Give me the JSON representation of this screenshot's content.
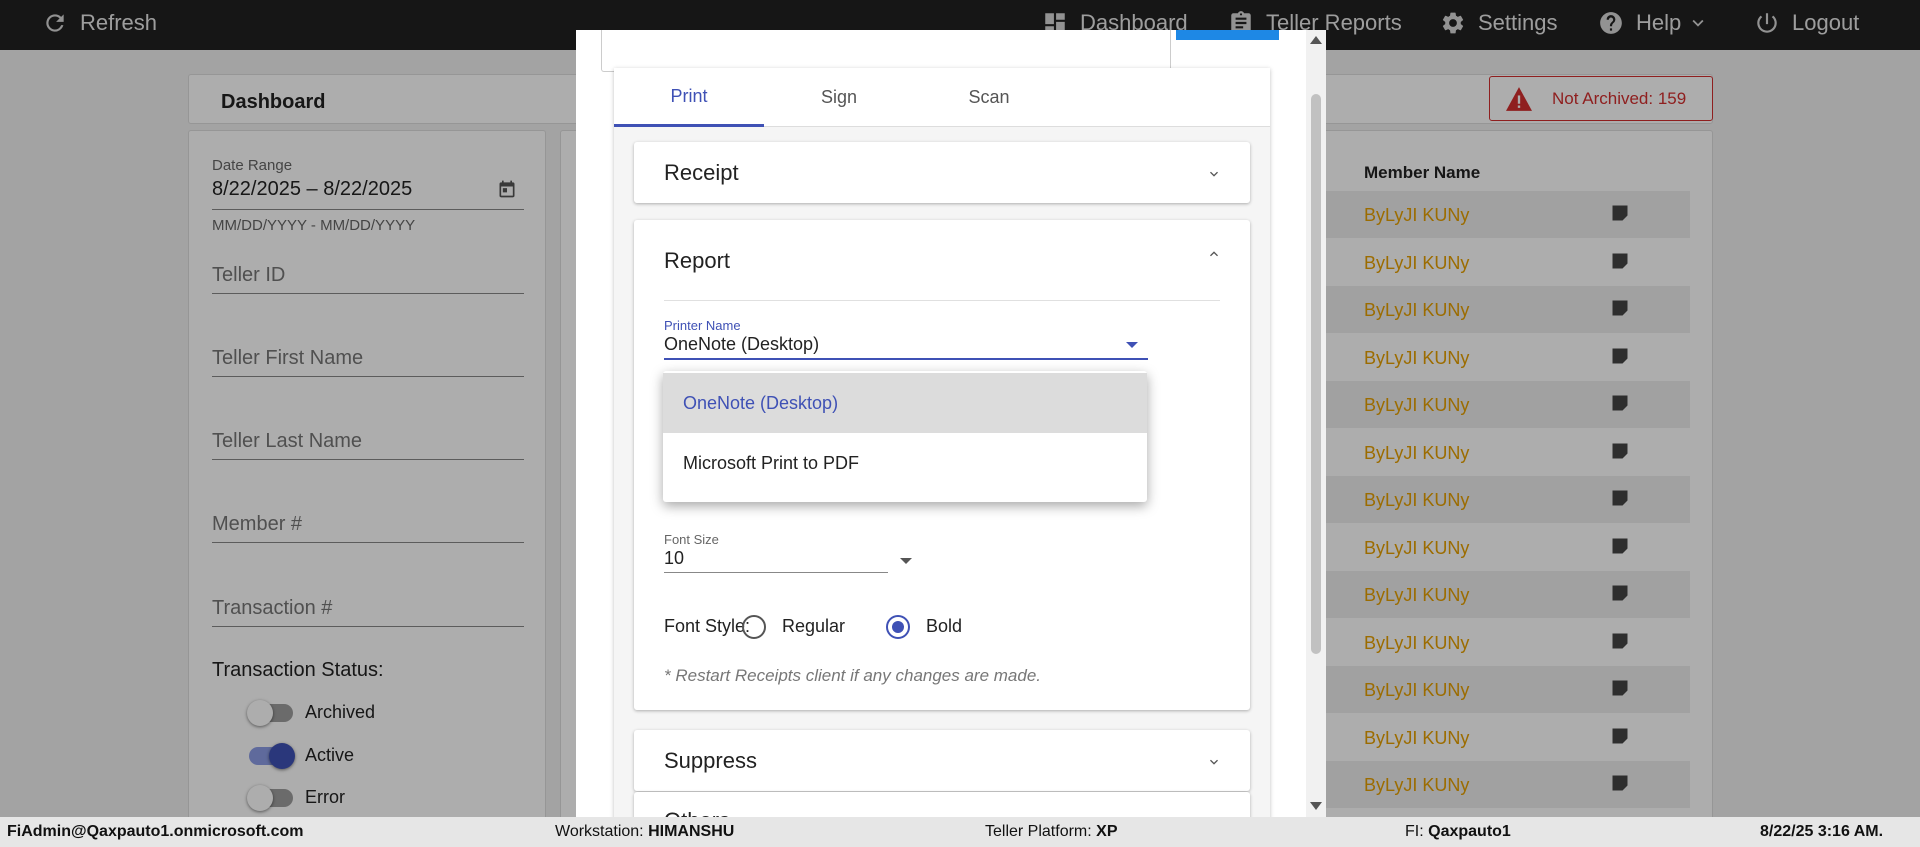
{
  "topbar": {
    "refresh": "Refresh",
    "dashboard": "Dashboard",
    "teller_reports": "Teller Reports",
    "settings": "Settings",
    "help": "Help",
    "logout": "Logout"
  },
  "dashboard": {
    "title": "Dashboard",
    "not_archived": "Not Archived: 159",
    "not_archived_color": "#d32f2f"
  },
  "filters": {
    "date_range_label": "Date Range",
    "date_range_value": "8/22/2025 – 8/22/2025",
    "date_hint": "MM/DD/YYYY - MM/DD/YYYY",
    "teller_id": "Teller ID",
    "teller_first_name": "Teller First Name",
    "teller_last_name": "Teller Last Name",
    "member_number": "Member #",
    "transaction_number": "Transaction #",
    "status_title": "Transaction Status:",
    "statuses": [
      {
        "label": "Archived",
        "on": false
      },
      {
        "label": "Active",
        "on": true
      },
      {
        "label": "Error",
        "on": false
      }
    ]
  },
  "table": {
    "member_name_header": "Member Name",
    "rows": [
      "ByLyJI KUNy",
      "ByLyJI KUNy",
      "ByLyJI KUNy",
      "ByLyJI KUNy",
      "ByLyJI KUNy",
      "ByLyJI KUNy",
      "ByLyJI KUNy",
      "ByLyJI KUNy",
      "ByLyJI KUNy",
      "ByLyJI KUNy",
      "ByLyJI KUNy",
      "ByLyJI KUNy",
      "ByLyJI KUNy"
    ],
    "name_color": "#e6a000"
  },
  "dialog": {
    "tabs": [
      "Print",
      "Sign",
      "Scan"
    ],
    "active_tab": "Print",
    "receipt_title": "Receipt",
    "report_title": "Report",
    "printer_label": "Printer Name",
    "printer_value": "OneNote (Desktop)",
    "printer_options": [
      "OneNote (Desktop)",
      "Microsoft Print to PDF"
    ],
    "font_size_label": "Font Size",
    "font_size_value": "10",
    "font_style_label": "Font Style:",
    "font_style_options": [
      "Regular",
      "Bold"
    ],
    "font_style_selected": "Bold",
    "restart_note": "* Restart Receipts client if any changes are made.",
    "suppress_title": "Suppress",
    "others_title": "Others",
    "accent_color": "#3f51b5"
  },
  "statusbar": {
    "user": "FiAdmin@Qaxpauto1.onmicrosoft.com",
    "workstation_label": "Workstation:",
    "workstation_value": "HIMANSHU",
    "platform_label": "Teller Platform:",
    "platform_value": "XP",
    "fi_label": "FI:",
    "fi_value": "Qaxpauto1",
    "datetime": "8/22/25 3:16 AM."
  }
}
